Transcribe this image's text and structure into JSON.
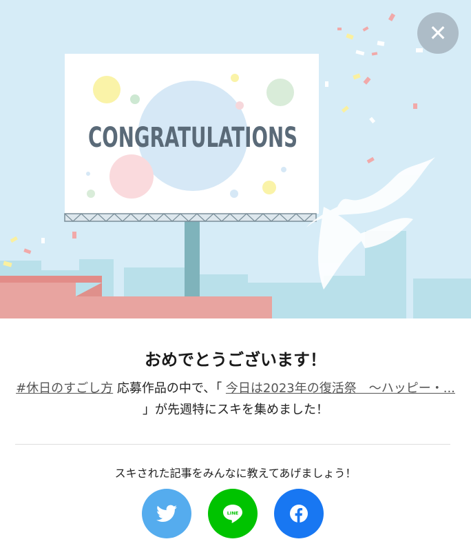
{
  "hero": {
    "billboard_text": "CONGRATULATIONS"
  },
  "dialog": {
    "close_label": "✕",
    "title": "おめでとうございます！",
    "hashtag": "#休日のすごし方",
    "text_1": " 応募作品の中で、「 ",
    "article_title": "今日は2023年の復活祭　～ハッピー・...",
    "text_2": " 」が先週特にスキを集めました！",
    "share_prompt": "スキされた記事をみんなに教えてあげましょう！"
  },
  "share_buttons": [
    {
      "name": "twitter",
      "icon": "twitter-bird-icon",
      "color": "#55acee"
    },
    {
      "name": "line",
      "icon": "line-icon",
      "label": "LINE",
      "color": "#00c300"
    },
    {
      "name": "facebook",
      "icon": "facebook-f-icon",
      "color": "#1877f2"
    }
  ],
  "colors": {
    "sky": "#d6ecf7",
    "roof": "#e8a4a0",
    "billboard_text": "#5a6a78"
  }
}
